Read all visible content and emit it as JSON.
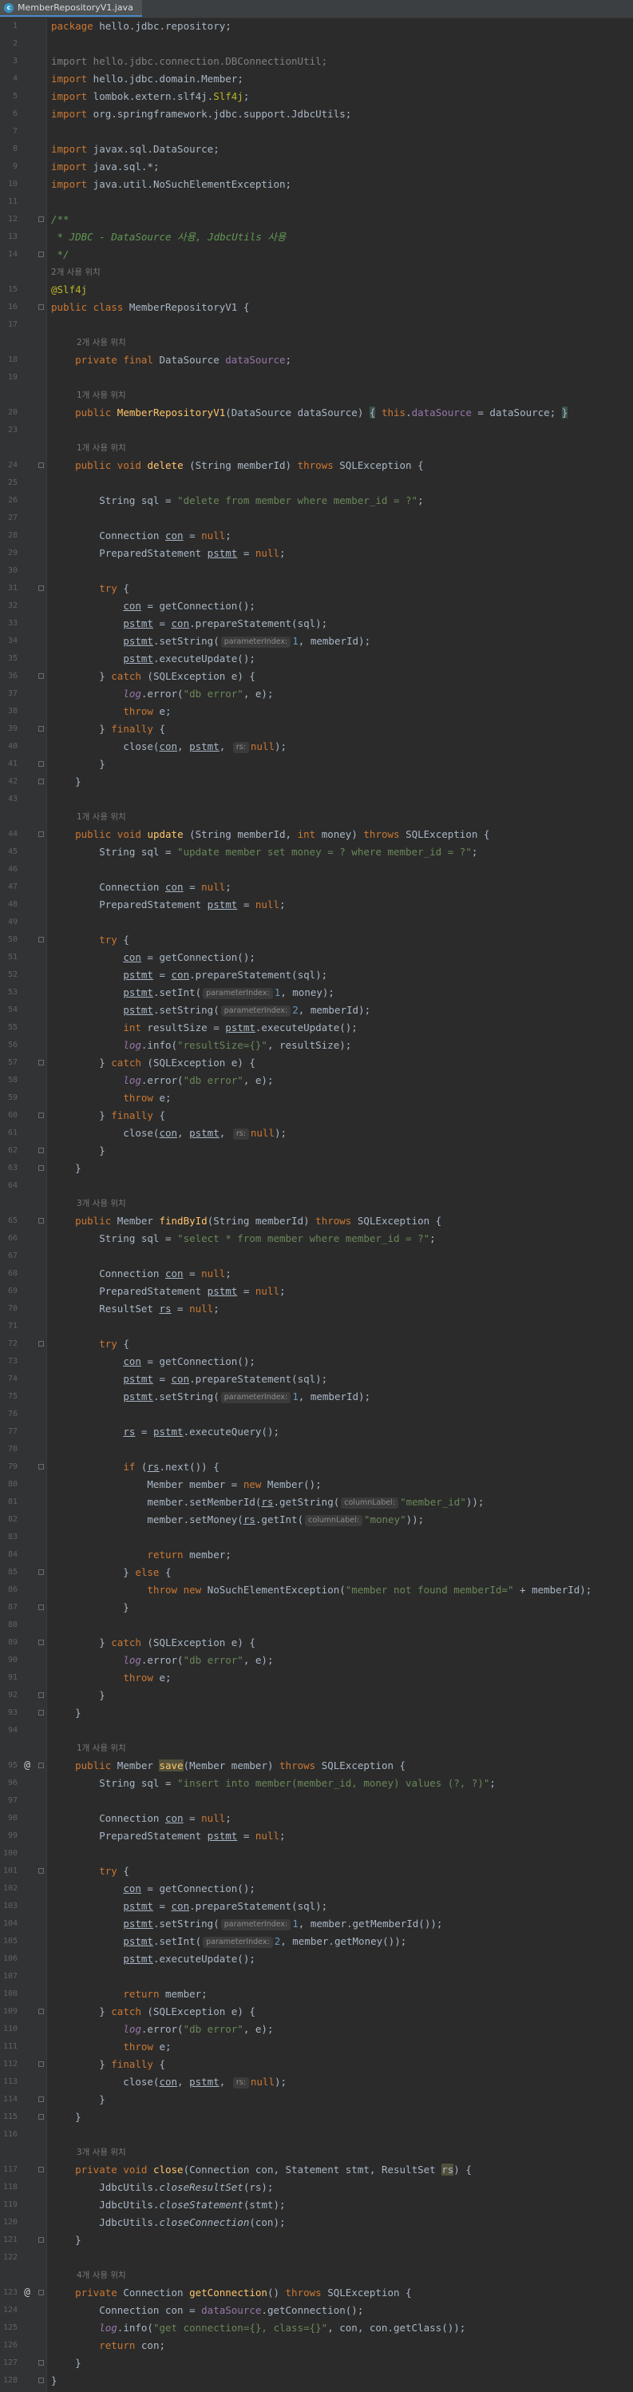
{
  "tab": {
    "filename": "MemberRepositoryV1.java",
    "icon": "c"
  },
  "lines": [
    {
      "n": "1",
      "h": "<span class=\"kw\">package</span> hello.jdbc.repository;"
    },
    {
      "n": "2",
      "h": ""
    },
    {
      "n": "3",
      "h": "<span class=\"cm\">import hello.jdbc.connection.DBConnectionUtil;</span>"
    },
    {
      "n": "4",
      "h": "<span class=\"kw\">import</span> hello.jdbc.domain.<span>Member</span>;"
    },
    {
      "n": "5",
      "h": "<span class=\"kw\">import</span> lombok.extern.slf4j.<span class=\"ann\">Slf4j</span>;"
    },
    {
      "n": "6",
      "h": "<span class=\"kw\">import</span> org.springframework.jdbc.support.JdbcUtils;"
    },
    {
      "n": "7",
      "h": ""
    },
    {
      "n": "8",
      "h": "<span class=\"kw\">import</span> javax.sql.DataSource;"
    },
    {
      "n": "9",
      "h": "<span class=\"kw\">import</span> java.sql.*;"
    },
    {
      "n": "10",
      "h": "<span class=\"kw\">import</span> java.util.NoSuchElementException;"
    },
    {
      "n": "11",
      "h": ""
    },
    {
      "n": "12",
      "h": "<span class=\"doc\">/**</span>"
    },
    {
      "n": "13",
      "h": "<span class=\"doc\"> * JDBC - DataSource 사용, JdbcUtils 사용</span>"
    },
    {
      "n": "14",
      "h": "<span class=\"doc\"> */</span>"
    },
    {
      "hint": "2개 사용 위치",
      "indent": 0
    },
    {
      "n": "15",
      "h": "<span class=\"ann\">@Slf4j</span>"
    },
    {
      "n": "16",
      "h": "<span class=\"kw\">public class</span> MemberRepositoryV1 {"
    },
    {
      "n": "17",
      "h": ""
    },
    {
      "hint": "2개 사용 위치",
      "indent": 1
    },
    {
      "n": "18",
      "h": "    <span class=\"kw\">private final</span> DataSource <span class=\"fld\">dataSource</span>;"
    },
    {
      "n": "19",
      "h": ""
    },
    {
      "hint": "1개 사용 위치",
      "indent": 1
    },
    {
      "n": "20",
      "h": "    <span class=\"kw\">public</span> <span class=\"fn\">MemberRepositoryV1</span>(DataSource dataSource) <span class=\"brk\">{</span> <span class=\"kw\">this</span>.<span class=\"fld\">dataSource</span> = dataSource; <span class=\"brk\">}</span>"
    },
    {
      "n": "23",
      "h": ""
    },
    {
      "hint": "1개 사용 위치",
      "indent": 1
    },
    {
      "n": "24",
      "h": "    <span class=\"kw\">public void</span> <span class=\"fn\">delete</span> (String memberId) <span class=\"kw\">throws</span> SQLException {"
    },
    {
      "n": "25",
      "h": ""
    },
    {
      "n": "26",
      "h": "        String sql = <span class=\"str\">\"delete from member where member_id = ?\"</span>;"
    },
    {
      "n": "27",
      "h": ""
    },
    {
      "n": "28",
      "h": "        Connection <span class=\"uv\">con</span> = <span class=\"kw\">null</span>;"
    },
    {
      "n": "29",
      "h": "        PreparedStatement <span class=\"uv\">pstmt</span> = <span class=\"kw\">null</span>;"
    },
    {
      "n": "30",
      "h": ""
    },
    {
      "n": "31",
      "h": "        <span class=\"kw\">try</span> {"
    },
    {
      "n": "32",
      "h": "            <span class=\"uv\">con</span> = getConnection();"
    },
    {
      "n": "33",
      "h": "            <span class=\"uv\">pstmt</span> = <span class=\"uv\">con</span>.prepareStatement(sql);"
    },
    {
      "n": "34",
      "h": "            <span class=\"uv\">pstmt</span>.setString(<span class=\"ph\">parameterIndex:</span><span class=\"num\">1</span>, memberId);"
    },
    {
      "n": "35",
      "h": "            <span class=\"uv\">pstmt</span>.executeUpdate();"
    },
    {
      "n": "36",
      "h": "        } <span class=\"kw\">catch</span> (SQLException e) {"
    },
    {
      "n": "37",
      "h": "            <span class=\"fld st\">log</span>.error(<span class=\"str\">\"db error\"</span>, e);"
    },
    {
      "n": "38",
      "h": "            <span class=\"kw\">throw</span> e;"
    },
    {
      "n": "39",
      "h": "        } <span class=\"kw\">finally</span> {"
    },
    {
      "n": "40",
      "h": "            close(<span class=\"uv\">con</span>, <span class=\"uv\">pstmt</span>, <span class=\"ph\">rs:</span><span class=\"kw\">null</span>);"
    },
    {
      "n": "41",
      "h": "        }"
    },
    {
      "n": "42",
      "h": "    }"
    },
    {
      "n": "43",
      "h": ""
    },
    {
      "hint": "1개 사용 위치",
      "indent": 1
    },
    {
      "n": "44",
      "h": "    <span class=\"kw\">public void</span> <span class=\"fn\">update</span> (String memberId, <span class=\"kw\">int</span> money) <span class=\"kw\">throws</span> SQLException {"
    },
    {
      "n": "45",
      "h": "        String sql = <span class=\"str\">\"update member set money = ? where member_id = ?\"</span>;"
    },
    {
      "n": "46",
      "h": ""
    },
    {
      "n": "47",
      "h": "        Connection <span class=\"uv\">con</span> = <span class=\"kw\">null</span>;"
    },
    {
      "n": "48",
      "h": "        PreparedStatement <span class=\"uv\">pstmt</span> = <span class=\"kw\">null</span>;"
    },
    {
      "n": "49",
      "h": ""
    },
    {
      "n": "50",
      "h": "        <span class=\"kw\">try</span> {"
    },
    {
      "n": "51",
      "h": "            <span class=\"uv\">con</span> = getConnection();"
    },
    {
      "n": "52",
      "h": "            <span class=\"uv\">pstmt</span> = <span class=\"uv\">con</span>.prepareStatement(sql);"
    },
    {
      "n": "53",
      "h": "            <span class=\"uv\">pstmt</span>.setInt(<span class=\"ph\">parameterIndex:</span><span class=\"num\">1</span>, money);"
    },
    {
      "n": "54",
      "h": "            <span class=\"uv\">pstmt</span>.setString(<span class=\"ph\">parameterIndex:</span><span class=\"num\">2</span>, memberId);"
    },
    {
      "n": "55",
      "h": "            <span class=\"kw\">int</span> resultSize = <span class=\"uv\">pstmt</span>.executeUpdate();"
    },
    {
      "n": "56",
      "h": "            <span class=\"fld st\">log</span>.info(<span class=\"str\">\"resultSize={}\"</span>, resultSize);"
    },
    {
      "n": "57",
      "h": "        } <span class=\"kw\">catch</span> (SQLException e) {"
    },
    {
      "n": "58",
      "h": "            <span class=\"fld st\">log</span>.error(<span class=\"str\">\"db error\"</span>, e);"
    },
    {
      "n": "59",
      "h": "            <span class=\"kw\">throw</span> e;"
    },
    {
      "n": "60",
      "h": "        } <span class=\"kw\">finally</span> {"
    },
    {
      "n": "61",
      "h": "            close(<span class=\"uv\">con</span>, <span class=\"uv\">pstmt</span>, <span class=\"ph\">rs:</span><span class=\"kw\">null</span>);"
    },
    {
      "n": "62",
      "h": "        }"
    },
    {
      "n": "63",
      "h": "    }"
    },
    {
      "n": "64",
      "h": ""
    },
    {
      "hint": "3개 사용 위치",
      "indent": 1
    },
    {
      "n": "65",
      "h": "    <span class=\"kw\">public</span> Member <span class=\"fn\">findById</span>(String memberId) <span class=\"kw\">throws</span> SQLException {"
    },
    {
      "n": "66",
      "h": "        String sql = <span class=\"str\">\"select * from member where member_id = ?\"</span>;"
    },
    {
      "n": "67",
      "h": ""
    },
    {
      "n": "68",
      "h": "        Connection <span class=\"uv\">con</span> = <span class=\"kw\">null</span>;"
    },
    {
      "n": "69",
      "h": "        PreparedStatement <span class=\"uv\">pstmt</span> = <span class=\"kw\">null</span>;"
    },
    {
      "n": "70",
      "h": "        ResultSet <span class=\"uv\">rs</span> = <span class=\"kw\">null</span>;"
    },
    {
      "n": "71",
      "h": ""
    },
    {
      "n": "72",
      "h": "        <span class=\"kw\">try</span> {"
    },
    {
      "n": "73",
      "h": "            <span class=\"uv\">con</span> = getConnection();"
    },
    {
      "n": "74",
      "h": "            <span class=\"uv\">pstmt</span> = <span class=\"uv\">con</span>.prepareStatement(sql);"
    },
    {
      "n": "75",
      "h": "            <span class=\"uv\">pstmt</span>.setString(<span class=\"ph\">parameterIndex:</span><span class=\"num\">1</span>, memberId);"
    },
    {
      "n": "76",
      "h": ""
    },
    {
      "n": "77",
      "h": "            <span class=\"uv\">rs</span> = <span class=\"uv\">pstmt</span>.executeQuery();"
    },
    {
      "n": "78",
      "h": ""
    },
    {
      "n": "79",
      "h": "            <span class=\"kw\">if</span> (<span class=\"uv\">rs</span>.next()) {"
    },
    {
      "n": "80",
      "h": "                Member member = <span class=\"kw\">new</span> Member();"
    },
    {
      "n": "81",
      "h": "                member.setMemberId(<span class=\"uv\">rs</span>.getString(<span class=\"ph\">columnLabel:</span><span class=\"str\">\"member_id\"</span>));"
    },
    {
      "n": "82",
      "h": "                member.setMoney(<span class=\"uv\">rs</span>.getInt(<span class=\"ph\">columnLabel:</span><span class=\"str\">\"money\"</span>));"
    },
    {
      "n": "83",
      "h": ""
    },
    {
      "n": "84",
      "h": "                <span class=\"kw\">return</span> member;"
    },
    {
      "n": "85",
      "h": "            } <span class=\"kw\">else</span> {"
    },
    {
      "n": "86",
      "h": "                <span class=\"kw\">throw new</span> NoSuchElementException(<span class=\"str\">\"member not found memberId=\"</span> + memberId);"
    },
    {
      "n": "87",
      "h": "            }"
    },
    {
      "n": "88",
      "h": ""
    },
    {
      "n": "89",
      "h": "        } <span class=\"kw\">catch</span> (SQLException e) {"
    },
    {
      "n": "90",
      "h": "            <span class=\"fld st\">log</span>.error(<span class=\"str\">\"db error\"</span>, e);"
    },
    {
      "n": "91",
      "h": "            <span class=\"kw\">throw</span> e;"
    },
    {
      "n": "92",
      "h": "        }"
    },
    {
      "n": "93",
      "h": "    }"
    },
    {
      "n": "94",
      "h": ""
    },
    {
      "hint": "1개 사용 위치",
      "indent": 1
    },
    {
      "n": "95",
      "mark": "@",
      "h": "    <span class=\"kw\">public</span> Member <span class=\"fn hl\">save</span>(Member member) <span class=\"kw\">throws</span> SQLException {"
    },
    {
      "n": "96",
      "h": "        String sql = <span class=\"str\">\"insert into member(member_id, money) values (?, ?)\"</span>;"
    },
    {
      "n": "97",
      "h": ""
    },
    {
      "n": "98",
      "h": "        Connection <span class=\"uv\">con</span> = <span class=\"kw\">null</span>;"
    },
    {
      "n": "99",
      "h": "        PreparedStatement <span class=\"uv\">pstmt</span> = <span class=\"kw\">null</span>;"
    },
    {
      "n": "100",
      "h": ""
    },
    {
      "n": "101",
      "h": "        <span class=\"kw\">try</span> {"
    },
    {
      "n": "102",
      "h": "            <span class=\"uv\">con</span> = getConnection();"
    },
    {
      "n": "103",
      "h": "            <span class=\"uv\">pstmt</span> = <span class=\"uv\">con</span>.prepareStatement(sql);"
    },
    {
      "n": "104",
      "h": "            <span class=\"uv\">pstmt</span>.setString(<span class=\"ph\">parameterIndex:</span><span class=\"num\">1</span>, member.getMemberId());"
    },
    {
      "n": "105",
      "h": "            <span class=\"uv\">pstmt</span>.setInt(<span class=\"ph\">parameterIndex:</span><span class=\"num\">2</span>, member.getMoney());"
    },
    {
      "n": "106",
      "h": "            <span class=\"uv\">pstmt</span>.executeUpdate();"
    },
    {
      "n": "107",
      "h": ""
    },
    {
      "n": "108",
      "h": "            <span class=\"kw\">return</span> member;"
    },
    {
      "n": "109",
      "h": "        } <span class=\"kw\">catch</span> (SQLException e) {"
    },
    {
      "n": "110",
      "h": "            <span class=\"fld st\">log</span>.error(<span class=\"str\">\"db error\"</span>, e);"
    },
    {
      "n": "111",
      "h": "            <span class=\"kw\">throw</span> e;"
    },
    {
      "n": "112",
      "h": "        } <span class=\"kw\">finally</span> {"
    },
    {
      "n": "113",
      "h": "            close(<span class=\"uv\">con</span>, <span class=\"uv\">pstmt</span>, <span class=\"ph\">rs:</span><span class=\"kw\">null</span>);"
    },
    {
      "n": "114",
      "h": "        }"
    },
    {
      "n": "115",
      "h": "    }"
    },
    {
      "n": "116",
      "h": ""
    },
    {
      "hint": "3개 사용 위치",
      "indent": 1
    },
    {
      "n": "117",
      "h": "    <span class=\"kw\">private void</span> <span class=\"fn\">close</span>(Connection con, Statement stmt, ResultSet <span class=\"hl\">rs</span>) {"
    },
    {
      "n": "118",
      "h": "        JdbcUtils.<span class=\"st\">closeResultSet</span>(rs);"
    },
    {
      "n": "119",
      "h": "        JdbcUtils.<span class=\"st\">closeStatement</span>(stmt);"
    },
    {
      "n": "120",
      "h": "        JdbcUtils.<span class=\"st\">closeConnection</span>(con);"
    },
    {
      "n": "121",
      "h": "    }"
    },
    {
      "n": "122",
      "h": ""
    },
    {
      "hint": "4개 사용 위치",
      "indent": 1
    },
    {
      "n": "123",
      "mark": "@",
      "h": "    <span class=\"kw\">private</span> Connection <span class=\"fn\">getConnection</span>() <span class=\"kw\">throws</span> SQLException {"
    },
    {
      "n": "124",
      "h": "        Connection con = <span class=\"fld\">dataSource</span>.getConnection();"
    },
    {
      "n": "125",
      "h": "        <span class=\"fld st\">log</span>.info(<span class=\"str\">\"get connection={}, class={}\"</span>, con, con.getClass());"
    },
    {
      "n": "126",
      "h": "        <span class=\"kw\">return</span> con;"
    },
    {
      "n": "127",
      "h": "    }"
    },
    {
      "n": "128",
      "h": "}"
    }
  ]
}
